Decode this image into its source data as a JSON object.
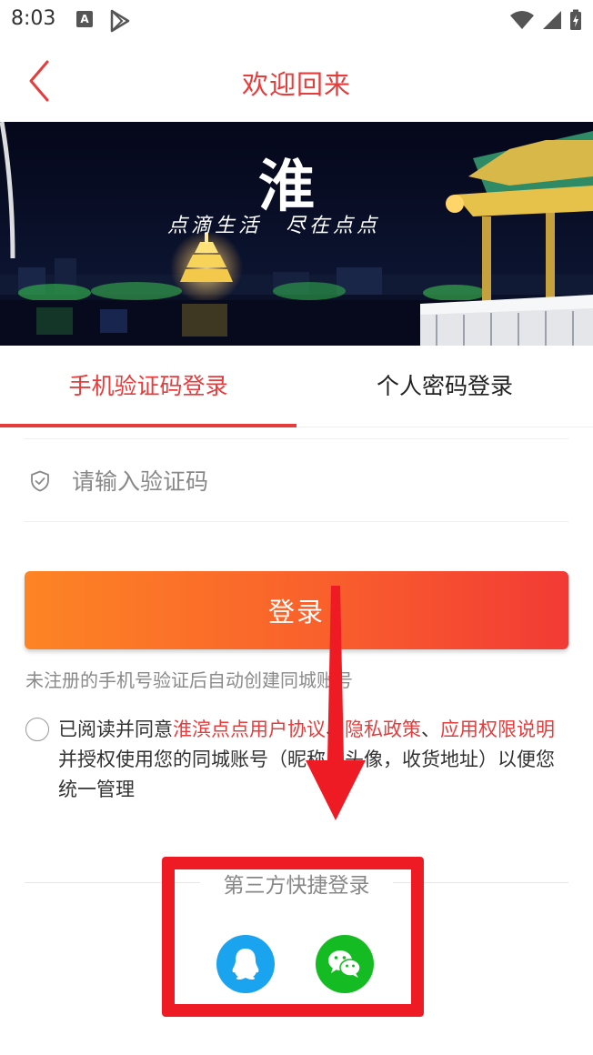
{
  "status_bar": {
    "time": "8:03",
    "app_icon_letter": "A"
  },
  "header": {
    "title": "欢迎回来"
  },
  "banner": {
    "logo_text": "淮",
    "slogan": "点滴生活　尽在点点"
  },
  "tabs": [
    {
      "label": "手机验证码登录",
      "active": true
    },
    {
      "label": "个人密码登录",
      "active": false
    }
  ],
  "code_field": {
    "placeholder": "请输入验证码",
    "value": ""
  },
  "login_button": {
    "label": "登录"
  },
  "hint": "未注册的手机号验证后自动创建同城账号",
  "agreement": {
    "prefix": "已阅读并同意",
    "link1": "淮滨点点用户协议",
    "sep1": "、",
    "link2": "隐私政策",
    "sep2": "、",
    "link3": "应用权限说明",
    "suffix": "并授权使用您的同城账号（昵称，头像，收货地址）以便您统一管理"
  },
  "third_party": {
    "title": "第三方快捷登录",
    "providers": [
      "qq-icon",
      "wechat-icon"
    ]
  },
  "colors": {
    "accent": "#e63c3c",
    "qq": "#1aa3ee",
    "wechat": "#15bb22",
    "annotation": "#ee1b24"
  }
}
